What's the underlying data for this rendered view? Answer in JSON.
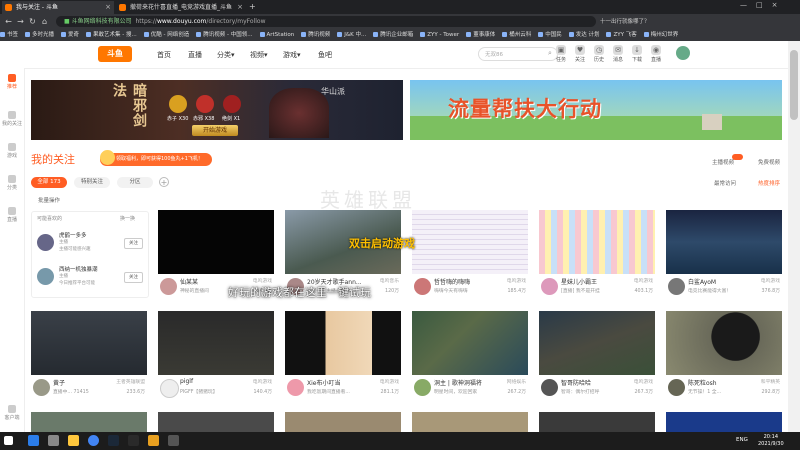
{
  "browser": {
    "tabs": [
      {
        "label": "我与关注 - 斗鱼",
        "active": true
      },
      {
        "label": "撤荷来花什喜直播_电竞游戏直播_斗鱼",
        "active": false
      }
    ],
    "url_prefix": "https://",
    "url_host": "www.douyu.com",
    "url_path": "/directory/myFollow",
    "url_info": "斗鱼网络科技有限公司",
    "tip": "十一出行就像哪了？",
    "bookmarks": [
      "书签",
      "多时光播",
      "爱奇",
      "果敢艺术集 - 搜...",
      "优酷 - 网络创造",
      "腾讯视频 - 中国领...",
      "ArtStation",
      "腾讯视频",
      "J&K 中... ",
      "腾讯企业邮箱",
      "ZYY - Tower",
      "董事康体",
      "桶州云科",
      "中国民",
      "发达 计划",
      "ZYY 飞客",
      "梅州幻世界"
    ]
  },
  "header": {
    "logo": "斗鱼",
    "nav": [
      "首页",
      "直播",
      "分类",
      "视频",
      "游戏",
      "鱼吧"
    ],
    "search_placeholder": "无双86",
    "icons": [
      {
        "name": "chest-icon",
        "label": "任务"
      },
      {
        "name": "follow-icon",
        "label": "关注"
      },
      {
        "name": "history-icon",
        "label": "历史"
      },
      {
        "name": "message-icon",
        "label": "消息"
      },
      {
        "name": "download-icon",
        "label": "下载"
      },
      {
        "name": "broadcast-icon",
        "label": "直播"
      },
      {
        "name": "bag-icon",
        "label": "背包"
      }
    ]
  },
  "sidebar": [
    {
      "label": "推荐",
      "active": true
    },
    {
      "label": "我的关注",
      "active": false
    },
    {
      "label": "游戏",
      "active": false
    },
    {
      "label": "分类",
      "active": false
    },
    {
      "label": "直播",
      "active": false
    },
    {
      "label": "客户端",
      "active": false
    }
  ],
  "banner1": {
    "title": "暗邪剑法",
    "school": "华山派",
    "items": [
      "赤子 X30",
      "赤邪 X38",
      "绝剑 X1"
    ],
    "button": "开始游戏"
  },
  "banner2": {
    "text": "流量帮扶大行动"
  },
  "section": {
    "title": "我的关注",
    "promo": "领取福利，即可获得100鱼丸+1飞机！",
    "filters": [
      {
        "label": "全部 173",
        "active": true
      },
      {
        "label": "特别关注",
        "active": false
      },
      {
        "label": "分区",
        "active": false
      }
    ],
    "add": "+",
    "batch": "批量操作",
    "right_links": [
      "主播视频",
      "免费视频"
    ],
    "sort_links": [
      "最常访问",
      "热度排序"
    ]
  },
  "left_panel": {
    "header": "可能喜欢的",
    "refresh": "换一换",
    "rows": [
      {
        "name": "虎鹤一多多",
        "sub1": "主播",
        "sub2": "主播可能感兴趣",
        "btn": "关注"
      },
      {
        "name": "西纳一机独暴潮",
        "sub1": "主播",
        "sub2": "今日推荐平台可能",
        "btn": "关注"
      }
    ]
  },
  "cards": [
    {
      "name": "仙某某",
      "sub": "神秘的直播间",
      "cat": "电鸣游戏",
      "heat": "54.3万"
    },
    {
      "name": "20岁天才歌手ann...",
      "sub": "这是一个主播心酸歌...",
      "cat": "电鸣音乐",
      "heat": "120万"
    },
    {
      "name": "哲哲嗨的嗨嗨",
      "sub": "嗨嗨今天有嗨嗨",
      "cat": "电鸣游戏",
      "heat": "185.4万"
    },
    {
      "name": "星妹儿小霸王",
      "sub": "[直播] 我不是开挂",
      "cat": "电鸣游戏",
      "heat": "403.1万"
    },
    {
      "name": "白鲨AyoM",
      "sub": "电竞比赛能得大富！",
      "cat": "电鸣游戏",
      "heat": "376.8万"
    },
    {
      "name": "黄子",
      "sub": "直播中... 71415",
      "cat": "王者英雄联盟",
      "heat": "233.6万"
    },
    {
      "name": "piglf",
      "sub": "PIGFF【猪猪玩】",
      "cat": "电鸣游戏",
      "heat": "140.4万"
    },
    {
      "name": "Xie布小叮当",
      "sub": "我吃饭期间直播看...",
      "cat": "电鸣游戏",
      "heat": "281.1万"
    },
    {
      "name": "洞主 | 歌神洞福将",
      "sub": "明星时间，欢迎回家",
      "cat": "网络娱乐",
      "heat": "267.2万"
    },
    {
      "name": "智哥防哈哈",
      "sub": "智哥：偶尔打招呼",
      "cat": "电鸣游戏",
      "heat": "267.3万"
    },
    {
      "name": "陈死粒osh",
      "sub": "无节操！1 全...",
      "cat": "和平精英",
      "heat": "292.8万"
    }
  ],
  "overlay": {
    "double_click": "双击启动游戏",
    "subtitle": "好玩的游戏都在这里一键试玩",
    "watermark": "英雄联盟"
  },
  "taskbar": {
    "lang": "ENG",
    "time": "20:14",
    "date": "2021/9/30"
  },
  "colors": {
    "accent": "#ff5d23",
    "banner2_text": "#e8532a"
  }
}
